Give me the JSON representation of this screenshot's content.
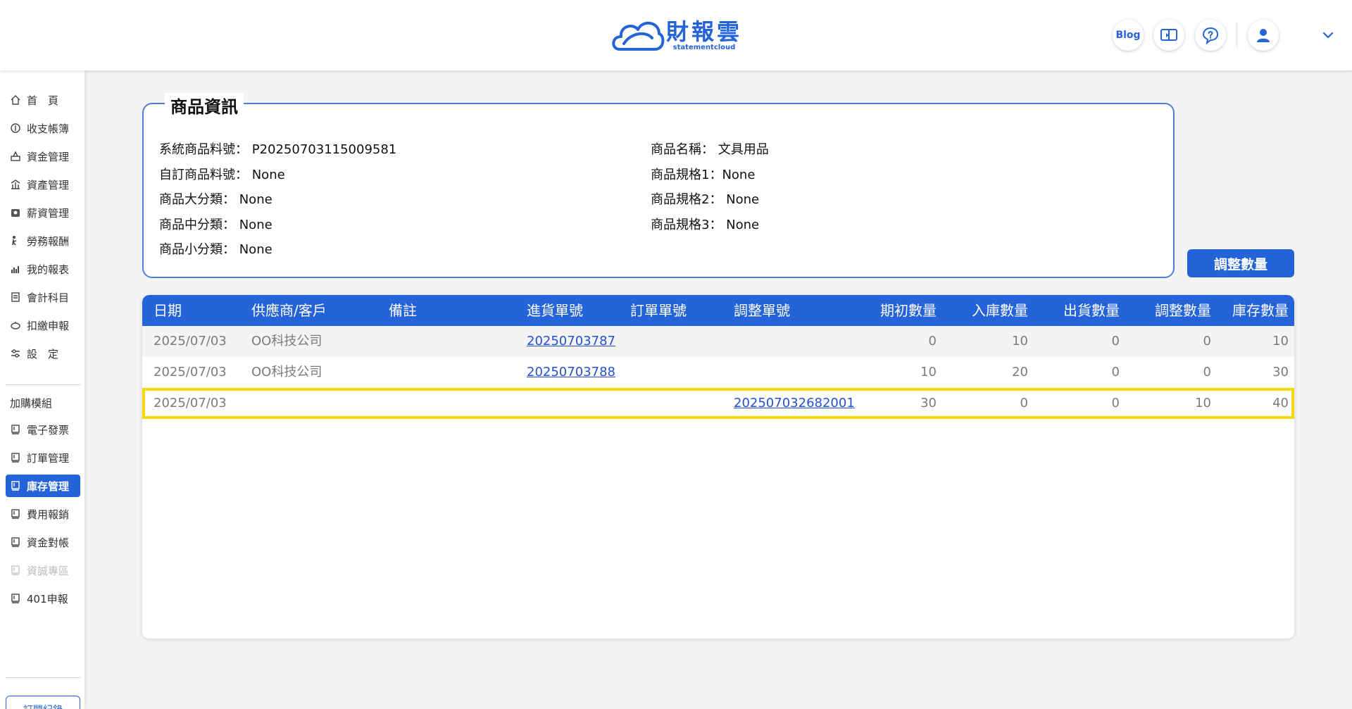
{
  "header": {
    "logo_cn": "財報雲",
    "logo_en": "statementcloud",
    "blog_label": "Blog"
  },
  "sidebar": {
    "items": [
      {
        "label": "首　頁",
        "icon": "home-icon"
      },
      {
        "label": "收支帳簿",
        "icon": "coin-icon"
      },
      {
        "label": "資金管理",
        "icon": "fund-icon"
      },
      {
        "label": "資產管理",
        "icon": "asset-icon"
      },
      {
        "label": "薪資管理",
        "icon": "salary-icon"
      },
      {
        "label": "勞務報酬",
        "icon": "labor-icon"
      },
      {
        "label": "我的報表",
        "icon": "report-icon"
      },
      {
        "label": "會計科目",
        "icon": "accounting-icon"
      },
      {
        "label": "扣繳申報",
        "icon": "withholding-icon"
      },
      {
        "label": "設　定",
        "icon": "settings-icon"
      }
    ],
    "addon_heading": "加購模組",
    "addons": [
      {
        "label": "電子發票",
        "state": "normal"
      },
      {
        "label": "訂單管理",
        "state": "normal"
      },
      {
        "label": "庫存管理",
        "state": "active"
      },
      {
        "label": "費用報銷",
        "state": "normal"
      },
      {
        "label": "資金對帳",
        "state": "normal"
      },
      {
        "label": "資誠專區",
        "state": "disabled"
      },
      {
        "label": "401申報",
        "state": "normal"
      }
    ],
    "subscribe_label": "訂閱紀錄"
  },
  "product_info": {
    "legend": "商品資訊",
    "left": [
      "系統商品料號： P20250703115009581",
      "自訂商品料號： None",
      "商品大分類： None",
      "商品中分類： None",
      "商品小分類： None"
    ],
    "right": [
      "商品名稱： 文具用品",
      "商品規格1：None",
      "商品規格2： None",
      "商品規格3： None"
    ]
  },
  "adjust_button_label": "調整數量",
  "table": {
    "headers": [
      "日期",
      "供應商/客戶",
      "備註",
      "進貨單號",
      "訂單單號",
      "調整單號",
      "期初數量",
      "入庫數量",
      "出貨數量",
      "調整數量",
      "庫存數量"
    ],
    "rows": [
      {
        "date": "2025/07/03",
        "party": "OO科技公司",
        "note": "",
        "purchase_no": "20250703787",
        "order_no": "",
        "adjust_no": "",
        "opening": "0",
        "in": "10",
        "out": "0",
        "adjust": "0",
        "stock": "10"
      },
      {
        "date": "2025/07/03",
        "party": "OO科技公司",
        "note": "",
        "purchase_no": "20250703788",
        "order_no": "",
        "adjust_no": "",
        "opening": "10",
        "in": "20",
        "out": "0",
        "adjust": "0",
        "stock": "30"
      },
      {
        "date": "2025/07/03",
        "party": "",
        "note": "",
        "purchase_no": "",
        "order_no": "",
        "adjust_no": "202507032682001",
        "opening": "30",
        "in": "0",
        "out": "0",
        "adjust": "10",
        "stock": "40"
      }
    ]
  },
  "colors": {
    "brand_blue": "#2563d8",
    "highlight_yellow": "#f5d90a",
    "link": "#2350d0"
  }
}
